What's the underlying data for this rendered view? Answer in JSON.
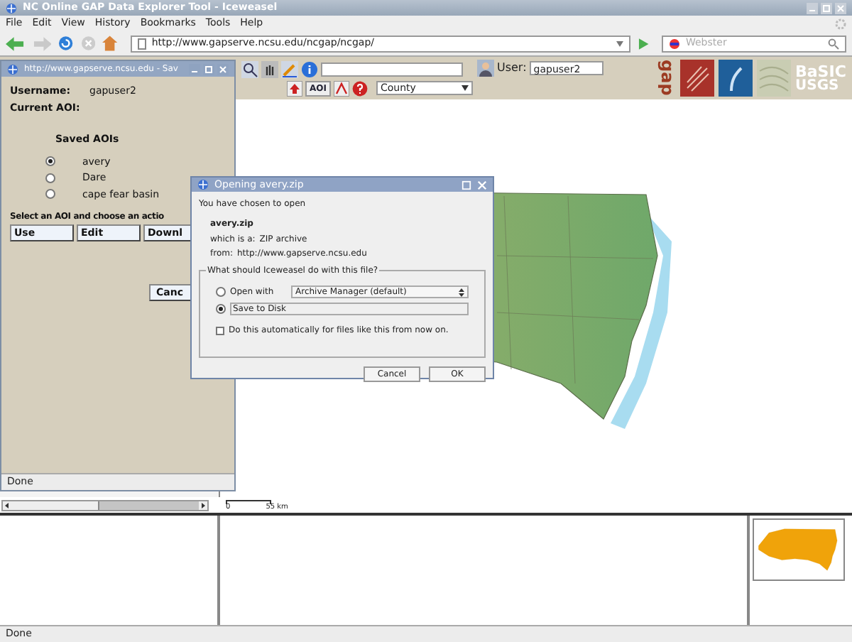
{
  "window": {
    "title": "NC Online GAP Data Explorer Tool - Iceweasel"
  },
  "menu": [
    "File",
    "Edit",
    "View",
    "History",
    "Bookmarks",
    "Tools",
    "Help"
  ],
  "nav": {
    "url": "http://www.gapserve.ncsu.edu/ncgap/ncgap/",
    "search_placeholder": "Webster"
  },
  "toolbar": {
    "aoi_button": "AOI",
    "user_label": "User:",
    "user_value": "gapuser2",
    "layer_select": "County",
    "logo_text": "gap",
    "basic_text": "BaSIC",
    "usgs_text": "USGS"
  },
  "scale": {
    "start": "0",
    "end": "55 km"
  },
  "status_bar": "Done",
  "popup": {
    "title": "http://www.gapserve.ncsu.edu - Sav",
    "username_label": "Username:",
    "username_value": "gapuser2",
    "current_aoi_label": "Current AOI:",
    "saved_heading": "Saved AOIs",
    "aois": [
      {
        "name": "avery",
        "selected": true
      },
      {
        "name": "Dare",
        "selected": false
      },
      {
        "name": "cape fear basin",
        "selected": false
      }
    ],
    "prompt": "Select an AOI and choose an actio",
    "buttons": [
      "Use",
      "Edit",
      "Downl"
    ],
    "cancel": "Canc",
    "status": "Done"
  },
  "dialog": {
    "title": "Opening avery.zip",
    "intro": "You have chosen to open",
    "filename": "avery.zip",
    "type_label": "which is a:",
    "type": "ZIP archive",
    "from_label": "from:",
    "from": "http://www.gapserve.ncsu.edu",
    "question": "What should Iceweasel do with this file?",
    "options": [
      {
        "kind": "open_with",
        "label": "Open with",
        "selected": false,
        "app": "Archive Manager (default)"
      },
      {
        "kind": "save",
        "label": "Save to Disk",
        "selected": true
      }
    ],
    "auto": {
      "label": "Do this automatically for files like this from now on.",
      "checked": false
    },
    "buttons": [
      "Cancel",
      "OK"
    ]
  }
}
